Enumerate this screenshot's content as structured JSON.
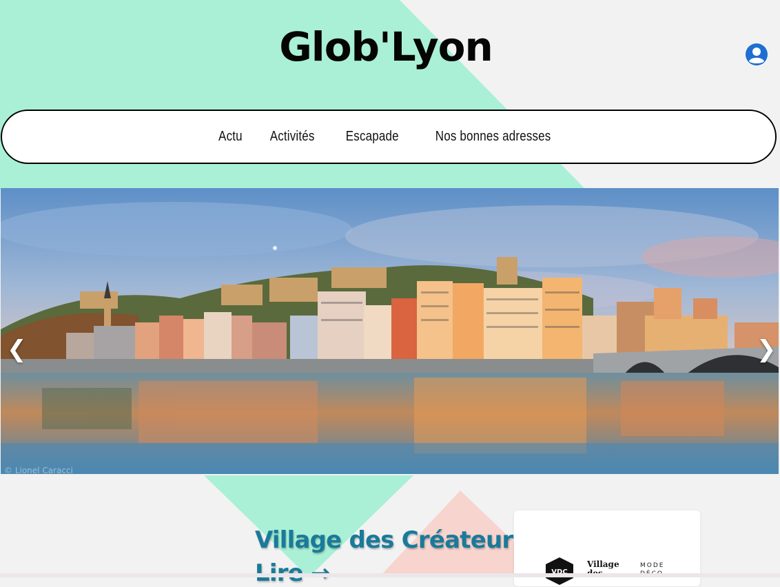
{
  "site": {
    "logo_text": "Glob'Lyon"
  },
  "header": {
    "account_icon": "account-circle-icon",
    "account_color": "#1f6fd1"
  },
  "nav": {
    "items": [
      {
        "label": "Actu"
      },
      {
        "label": "Activités"
      },
      {
        "label": "Escapade"
      },
      {
        "label": "Nos bonnes adresses"
      }
    ]
  },
  "hero": {
    "prev_arrow": "❮",
    "next_arrow": "❯",
    "credit": "© Lionel Caracci"
  },
  "post": {
    "title": "Village des Créateurs",
    "link_label": "Lire →"
  },
  "card": {
    "logo_mark": "VDC",
    "name_line1": "Village",
    "name_line2": "des",
    "tag_line1": "MODE",
    "tag_line2": "DÉCO"
  },
  "colors": {
    "mint": "#a9f0d6",
    "pink": "#f7d4cd",
    "background": "#f2f2f2",
    "title_blue": "#1a7a9a"
  }
}
